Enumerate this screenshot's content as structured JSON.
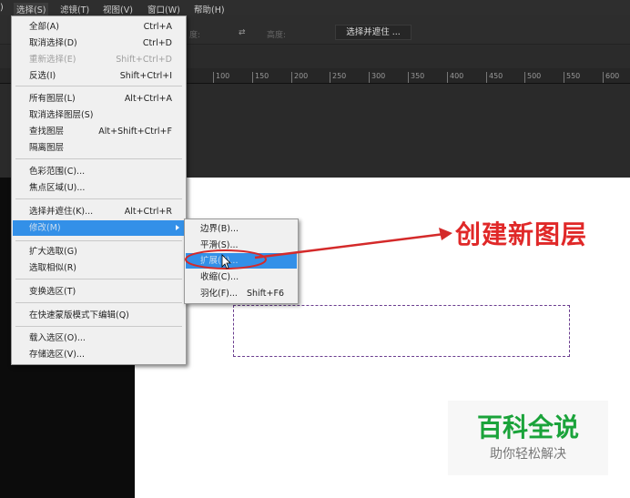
{
  "menubar": {
    "items": [
      ")",
      "选择(S)",
      "滤镜(T)",
      "视图(V)",
      "窗口(W)",
      "帮助(H)"
    ]
  },
  "options": {
    "label1": "度:",
    "label2": "高度:",
    "select_and_mask": "选择并遮住 ..."
  },
  "ruler": [
    "100",
    "150",
    "200",
    "250",
    "300",
    "350",
    "400",
    "450",
    "500",
    "550",
    "600"
  ],
  "select_menu": {
    "items": [
      {
        "label": "全部(A)",
        "shortcut": "Ctrl+A"
      },
      {
        "label": "取消选择(D)",
        "shortcut": "Ctrl+D"
      },
      {
        "label": "重新选择(E)",
        "shortcut": "Shift+Ctrl+D"
      },
      {
        "label": "反选(I)",
        "shortcut": "Shift+Ctrl+I"
      },
      {
        "label": "所有图层(L)",
        "shortcut": "Alt+Ctrl+A"
      },
      {
        "label": "取消选择图层(S)",
        "shortcut": ""
      },
      {
        "label": "查找图层",
        "shortcut": "Alt+Shift+Ctrl+F"
      },
      {
        "label": "隔离图层",
        "shortcut": ""
      },
      {
        "label": "色彩范围(C)...",
        "shortcut": ""
      },
      {
        "label": "焦点区域(U)...",
        "shortcut": ""
      },
      {
        "label": "选择并遮住(K)...",
        "shortcut": "Alt+Ctrl+R"
      },
      {
        "label": "修改(M)",
        "shortcut": ""
      },
      {
        "label": "扩大选取(G)",
        "shortcut": ""
      },
      {
        "label": "选取相似(R)",
        "shortcut": ""
      },
      {
        "label": "变换选区(T)",
        "shortcut": ""
      },
      {
        "label": "在快速蒙版模式下编辑(Q)",
        "shortcut": ""
      },
      {
        "label": "载入选区(O)...",
        "shortcut": ""
      },
      {
        "label": "存储选区(V)...",
        "shortcut": ""
      }
    ]
  },
  "modify_submenu": {
    "items": [
      {
        "label": "边界(B)...",
        "shortcut": ""
      },
      {
        "label": "平滑(S)...",
        "shortcut": ""
      },
      {
        "label": "扩展(E)...",
        "shortcut": ""
      },
      {
        "label": "收缩(C)...",
        "shortcut": ""
      },
      {
        "label": "羽化(F)...",
        "shortcut": "Shift+F6"
      }
    ]
  },
  "annotation": "创建新图层",
  "watermark": {
    "title": "百科全说",
    "subtitle": "助你轻松解决"
  },
  "colors": {
    "highlight": "#3390e8",
    "annotation": "#e02828",
    "watermark": "#1aa33a"
  }
}
